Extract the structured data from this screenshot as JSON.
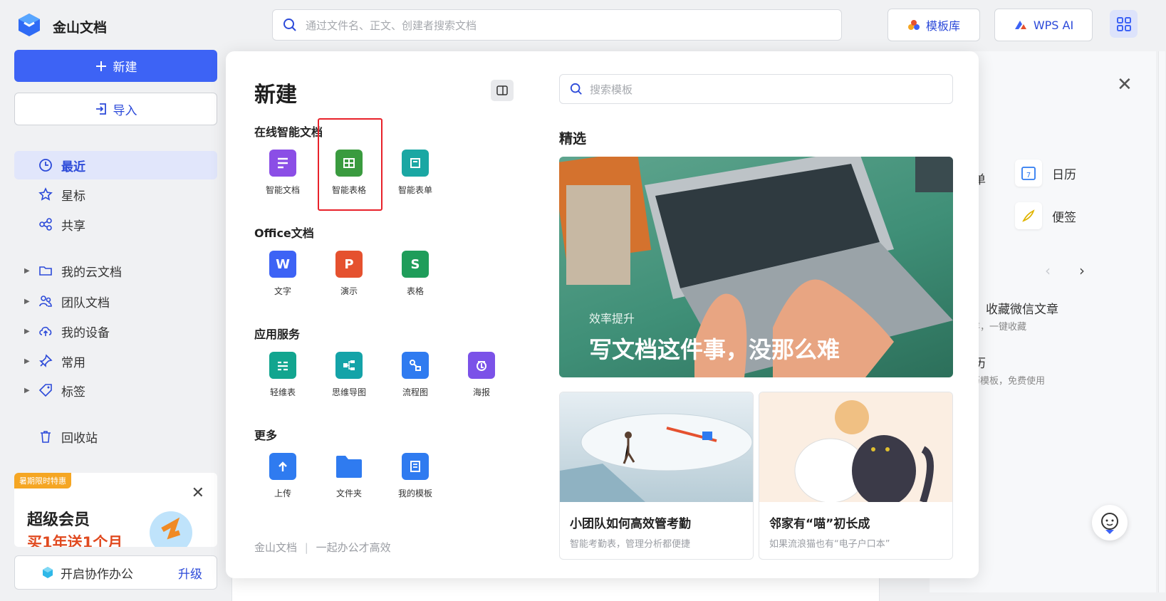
{
  "brand": {
    "name": "金山文档"
  },
  "search": {
    "placeholder": "通过文件名、正文、创建者搜索文档"
  },
  "topbar": {
    "template_label": "模板库",
    "ai_label": "WPS AI"
  },
  "sidebar": {
    "new_label": "新建",
    "import_label": "导入",
    "nav": [
      {
        "label": "最近",
        "active": true
      },
      {
        "label": "星标"
      },
      {
        "label": "共享"
      },
      {
        "label": "我的云文档"
      },
      {
        "label": "团队文档"
      },
      {
        "label": "我的设备"
      },
      {
        "label": "常用"
      },
      {
        "label": "标签"
      },
      {
        "label": "回收站"
      }
    ],
    "promo": {
      "badge": "暑期限时特惠",
      "title": "超级会员",
      "subtitle": "买1年送1个月"
    },
    "collab": {
      "label": "开启协作办公",
      "upgrade": "升级"
    }
  },
  "modal": {
    "title": "新建",
    "sections": [
      {
        "title": "在线智能文档",
        "items": [
          {
            "label": "智能文档",
            "color": "#8b4ee6",
            "icon": "smart-doc-icon"
          },
          {
            "label": "智能表格",
            "color": "#3a9b3f",
            "icon": "smart-sheet-icon"
          },
          {
            "label": "智能表单",
            "color": "#1aa7a3",
            "icon": "smart-form-icon"
          }
        ]
      },
      {
        "title": "Office文档",
        "items": [
          {
            "label": "文字",
            "color": "#3d63f5",
            "glyph": "W",
            "icon": "word-icon"
          },
          {
            "label": "演示",
            "color": "#e5512f",
            "glyph": "P",
            "icon": "ppt-icon"
          },
          {
            "label": "表格",
            "color": "#1f9d5a",
            "glyph": "S",
            "icon": "sheet-icon"
          }
        ]
      },
      {
        "title": "应用服务",
        "items": [
          {
            "label": "轻维表",
            "color": "#12a58f",
            "icon": "light-table-icon"
          },
          {
            "label": "思维导图",
            "color": "#14a3a8",
            "icon": "mindmap-icon"
          },
          {
            "label": "流程图",
            "color": "#2f7bf0",
            "icon": "flowchart-icon"
          },
          {
            "label": "海报",
            "color": "#7b52e8",
            "icon": "poster-icon"
          }
        ]
      },
      {
        "title": "更多",
        "items": [
          {
            "label": "上传",
            "color": "#2f7bf0",
            "icon": "upload-icon"
          },
          {
            "label": "文件夹",
            "color": "#2f7bf0",
            "icon": "folder-icon"
          },
          {
            "label": "我的模板",
            "color": "#2f7bf0",
            "icon": "my-template-icon"
          }
        ]
      }
    ],
    "footer": {
      "brand": "金山文档",
      "separator": "|",
      "slogan": "一起办公才高效"
    },
    "template_search_placeholder": "搜索模板",
    "featured_title": "精选",
    "hero": {
      "small": "效率提升",
      "big": "写文档这件事，没那么难"
    },
    "cards": [
      {
        "title": "小团队如何高效管考勤",
        "subtitle": "智能考勤表，管理分析都便捷"
      },
      {
        "title": "邻家有“喵”初长成",
        "subtitle": "如果流浪猫也有“电子户口本”"
      }
    ]
  },
  "right_panel": {
    "form_partial": "表单",
    "calendar": "日历",
    "note": "便签",
    "calendar_number": "7",
    "tip1_title": "巧：收藏微信文章",
    "tip1_sub": "保存，一键收藏",
    "tip2_title": "简历",
    "tip2_sub": "简历模板，免费使用"
  }
}
